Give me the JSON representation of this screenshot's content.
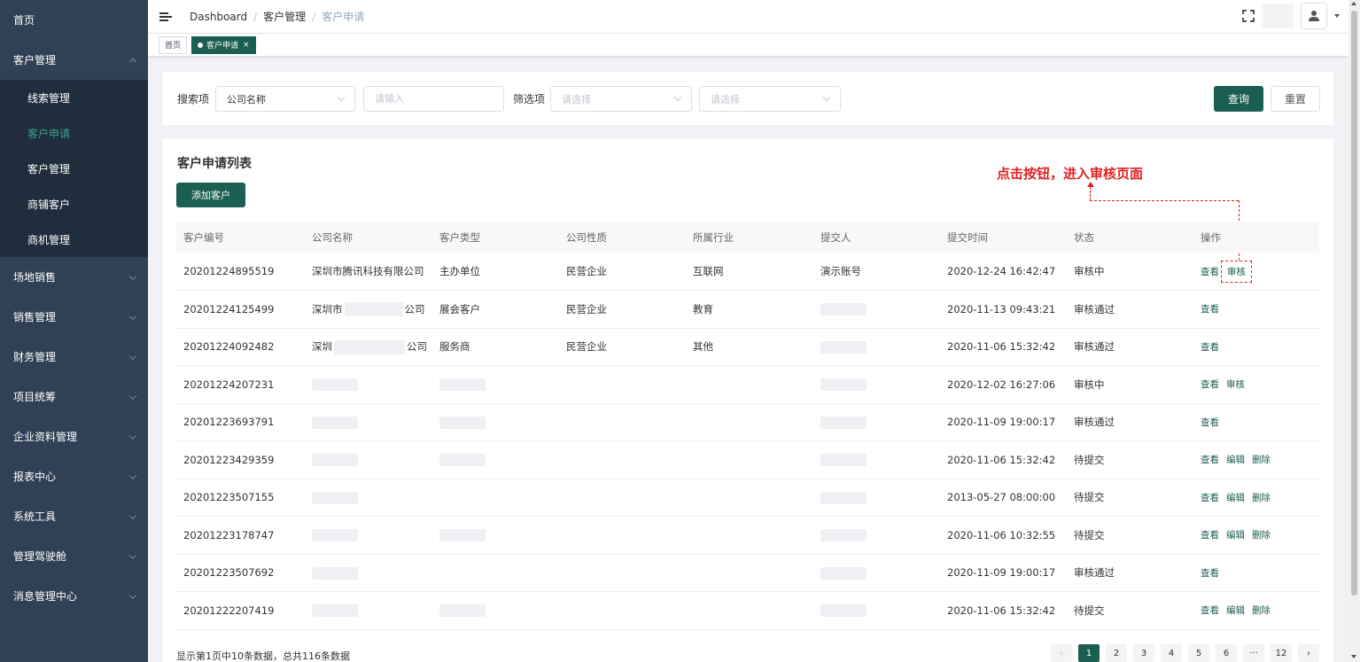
{
  "sidebar": {
    "items": [
      {
        "label": "首页"
      },
      {
        "label": "客户管理"
      },
      {
        "label": "场地销售"
      },
      {
        "label": "销售管理"
      },
      {
        "label": "财务管理"
      },
      {
        "label": "项目统筹"
      },
      {
        "label": "企业资料管理"
      },
      {
        "label": "报表中心"
      },
      {
        "label": "系统工具"
      },
      {
        "label": "管理驾驶舱"
      },
      {
        "label": "消息管理中心"
      }
    ],
    "sub_items": [
      {
        "label": "线索管理"
      },
      {
        "label": "客户申请"
      },
      {
        "label": "客户管理"
      },
      {
        "label": "商铺客户"
      },
      {
        "label": "商机管理"
      }
    ]
  },
  "breadcrumb": [
    "Dashboard",
    "客户管理",
    "客户申请"
  ],
  "tags": [
    {
      "label": "首页"
    },
    {
      "label": "客户申请"
    }
  ],
  "search": {
    "label": "搜索项",
    "field_value": "公司名称",
    "input_placeholder": "请输入",
    "filter_label": "筛选项",
    "filter1_placeholder": "请选择",
    "filter2_placeholder": "请选择",
    "query_button": "查询",
    "reset_button": "重置"
  },
  "list": {
    "title": "客户申请列表",
    "add_button": "添加客户",
    "annotation": "点击按钮，进入审核页面",
    "columns": [
      "客户编号",
      "公司名称",
      "客户类型",
      "公司性质",
      "所属行业",
      "提交人",
      "提交时间",
      "状态",
      "操作"
    ],
    "rows": [
      {
        "id": "20201224895519",
        "company": "深圳市腾讯科技有限公司",
        "type": "主办单位",
        "nature": "民营企业",
        "industry": "互联网",
        "submitter": "演示账号",
        "time": "2020-12-24 16:42:47",
        "status": "审核中",
        "actions": [
          "查看",
          "审核"
        ]
      },
      {
        "id": "20201224125499",
        "company_prefix": "深圳市",
        "company_suffix": "公司",
        "type": "展会客户",
        "nature": "民营企业",
        "industry": "教育",
        "submitter": "",
        "time": "2020-11-13 09:43:21",
        "status": "审核通过",
        "actions": [
          "查看"
        ]
      },
      {
        "id": "20201224092482",
        "company_prefix": "深圳",
        "company_suffix": "公司",
        "type": "服务商",
        "nature": "民营企业",
        "industry": "其他",
        "submitter": "",
        "time": "2020-11-06 15:32:42",
        "status": "审核通过",
        "actions": [
          "查看"
        ]
      },
      {
        "id": "20201224207231",
        "time": "2020-12-02 16:27:06",
        "status": "审核中",
        "actions": [
          "查看",
          "审核"
        ]
      },
      {
        "id": "20201223693791",
        "time": "2020-11-09 19:00:17",
        "status": "审核通过",
        "actions": [
          "查看"
        ]
      },
      {
        "id": "20201223429359",
        "time": "2020-11-06 15:32:42",
        "status": "待提交",
        "actions": [
          "查看",
          "编辑",
          "删除"
        ]
      },
      {
        "id": "20201223507155",
        "time": "2013-05-27 08:00:00",
        "status": "待提交",
        "actions": [
          "查看",
          "编辑",
          "删除"
        ]
      },
      {
        "id": "20201223178747",
        "time": "2020-11-06 10:32:55",
        "status": "待提交",
        "actions": [
          "查看",
          "编辑",
          "删除"
        ]
      },
      {
        "id": "20201223507692",
        "time": "2020-11-09 19:00:17",
        "status": "审核通过",
        "actions": [
          "查看"
        ]
      },
      {
        "id": "20201222207419",
        "time": "2020-11-06 15:32:42",
        "status": "待提交",
        "actions": [
          "查看",
          "编辑",
          "删除"
        ]
      }
    ],
    "footer_info": "显示第1页中10条数据，总共116条数据"
  },
  "pagination": {
    "pages": [
      "1",
      "2",
      "3",
      "4",
      "5",
      "6",
      "···",
      "12"
    ],
    "prev": "‹",
    "next": "›",
    "current": "1"
  },
  "colors": {
    "sidebar_bg": "#304156",
    "submenu_bg": "#1f2d3d",
    "primary": "#1b5e52",
    "annotation": "#e02020"
  }
}
